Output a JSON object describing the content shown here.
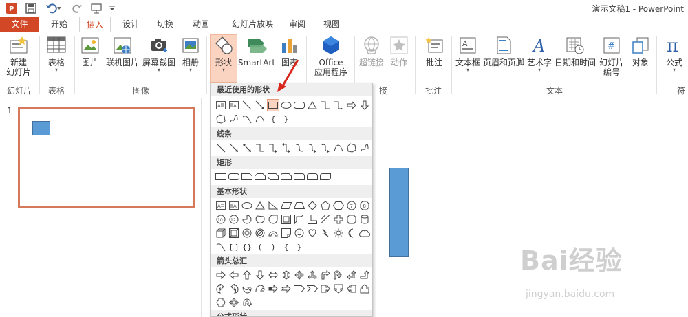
{
  "window": {
    "title": "演示文稿1 - PowerPoint"
  },
  "tabs": [
    "文件",
    "开始",
    "插入",
    "设计",
    "切换",
    "动画",
    "幻灯片放映",
    "审阅",
    "视图"
  ],
  "ribbon": {
    "buttons": {
      "new_slide": "新建",
      "new_slide2": "幻灯片",
      "table": "表格",
      "picture": "图片",
      "online_picture": "联机图片",
      "screenshot": "屏幕截图",
      "album": "相册",
      "shapes": "形状",
      "smartart": "SmartArt",
      "chart": "图表",
      "office_apps": "Office",
      "office_apps2": "应用程序",
      "hyperlink": "超链接",
      "action": "动作",
      "comment": "批注",
      "textbox": "文本框",
      "header_footer": "页眉和页脚",
      "wordart": "艺术字",
      "datetime": "日期和时间",
      "slide_number": "幻灯片",
      "slide_number2": "编号",
      "object": "对象",
      "equation": "公式"
    },
    "groups": {
      "slides": "幻灯片",
      "tables": "表格",
      "images": "图像",
      "links_tail": "接",
      "comments": "批注",
      "text": "文本",
      "symbols_head": "符"
    }
  },
  "slides_pane": {
    "slide_number": "1"
  },
  "gallery": {
    "sections": {
      "recent": "最近使用的形状",
      "lines": "线条",
      "rectangles": "矩形",
      "basic": "基本形状",
      "arrows": "箭头总汇",
      "equation": "公式形状"
    }
  },
  "watermark": {
    "brand": "Bai经验",
    "url": "jingyan.baidu.com"
  },
  "colors": {
    "accent": "#d24726",
    "shape_fill": "#5b9bd5",
    "selection": "#fad3c1"
  }
}
